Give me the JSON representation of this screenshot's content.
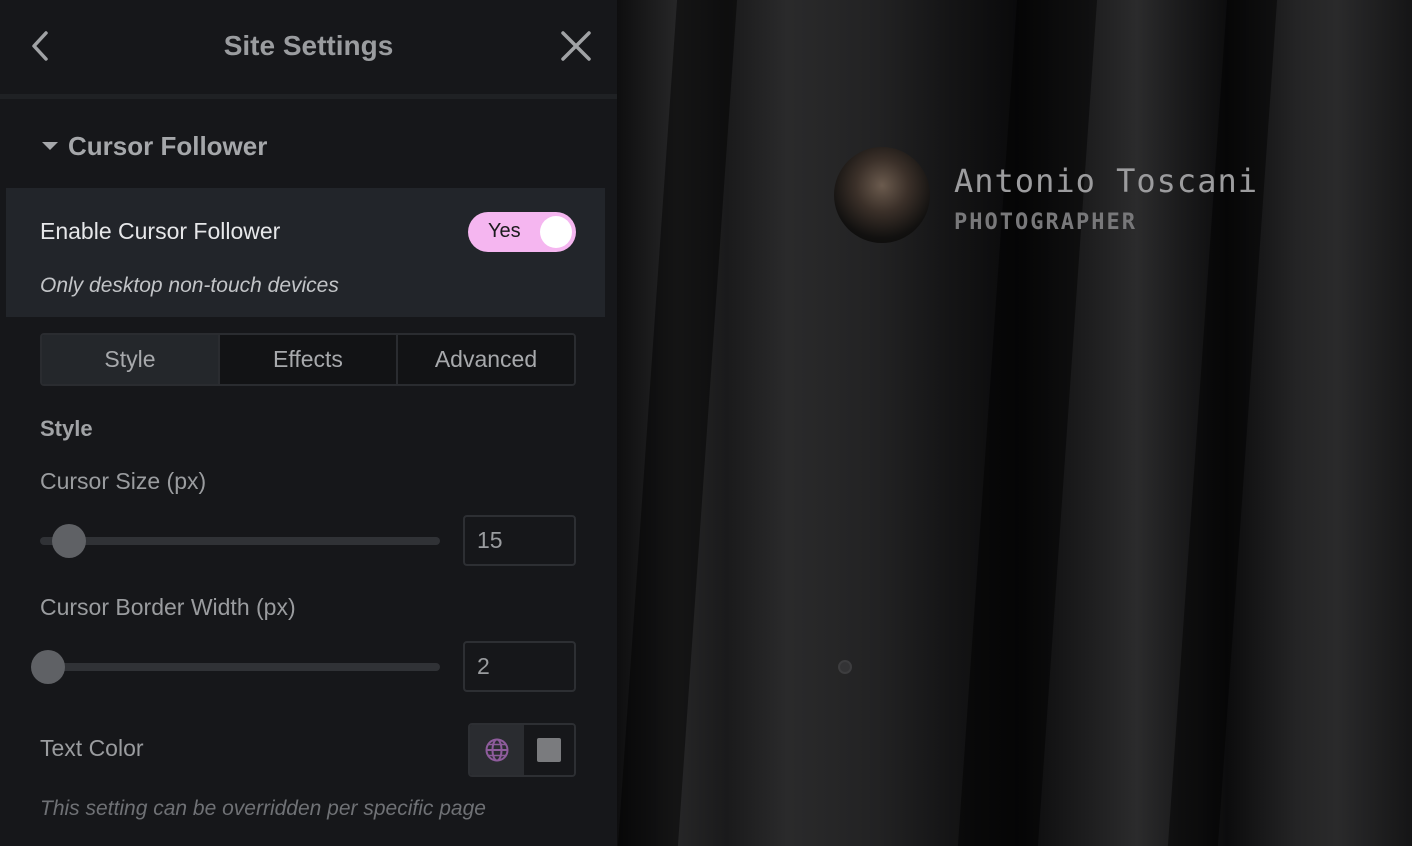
{
  "header": {
    "title": "Site Settings",
    "back_icon": "chevron-left-icon",
    "close_icon": "close-icon"
  },
  "section": {
    "title": "Cursor Follower",
    "caret_icon": "caret-down-icon"
  },
  "enable": {
    "label": "Enable Cursor Follower",
    "toggle_label": "Yes",
    "toggle_on": true,
    "toggle_color": "#f5b6f0",
    "hint": "Only desktop non-touch devices"
  },
  "tabs": [
    {
      "label": "Style",
      "active": true
    },
    {
      "label": "Effects",
      "active": false
    },
    {
      "label": "Advanced",
      "active": false
    }
  ],
  "style": {
    "heading": "Style",
    "cursor_size": {
      "label": "Cursor Size (px)",
      "value": "15"
    },
    "border_width": {
      "label": "Cursor Border Width (px)",
      "value": "2"
    },
    "text_color": {
      "label": "Text Color",
      "globe_icon": "globe-icon",
      "swatch_color": "#7a7b7e"
    },
    "footer_hint": "This setting can be overridden per specific page"
  },
  "preview": {
    "name": "Antonio Toscani",
    "role": "PHOTOGRAPHER"
  }
}
